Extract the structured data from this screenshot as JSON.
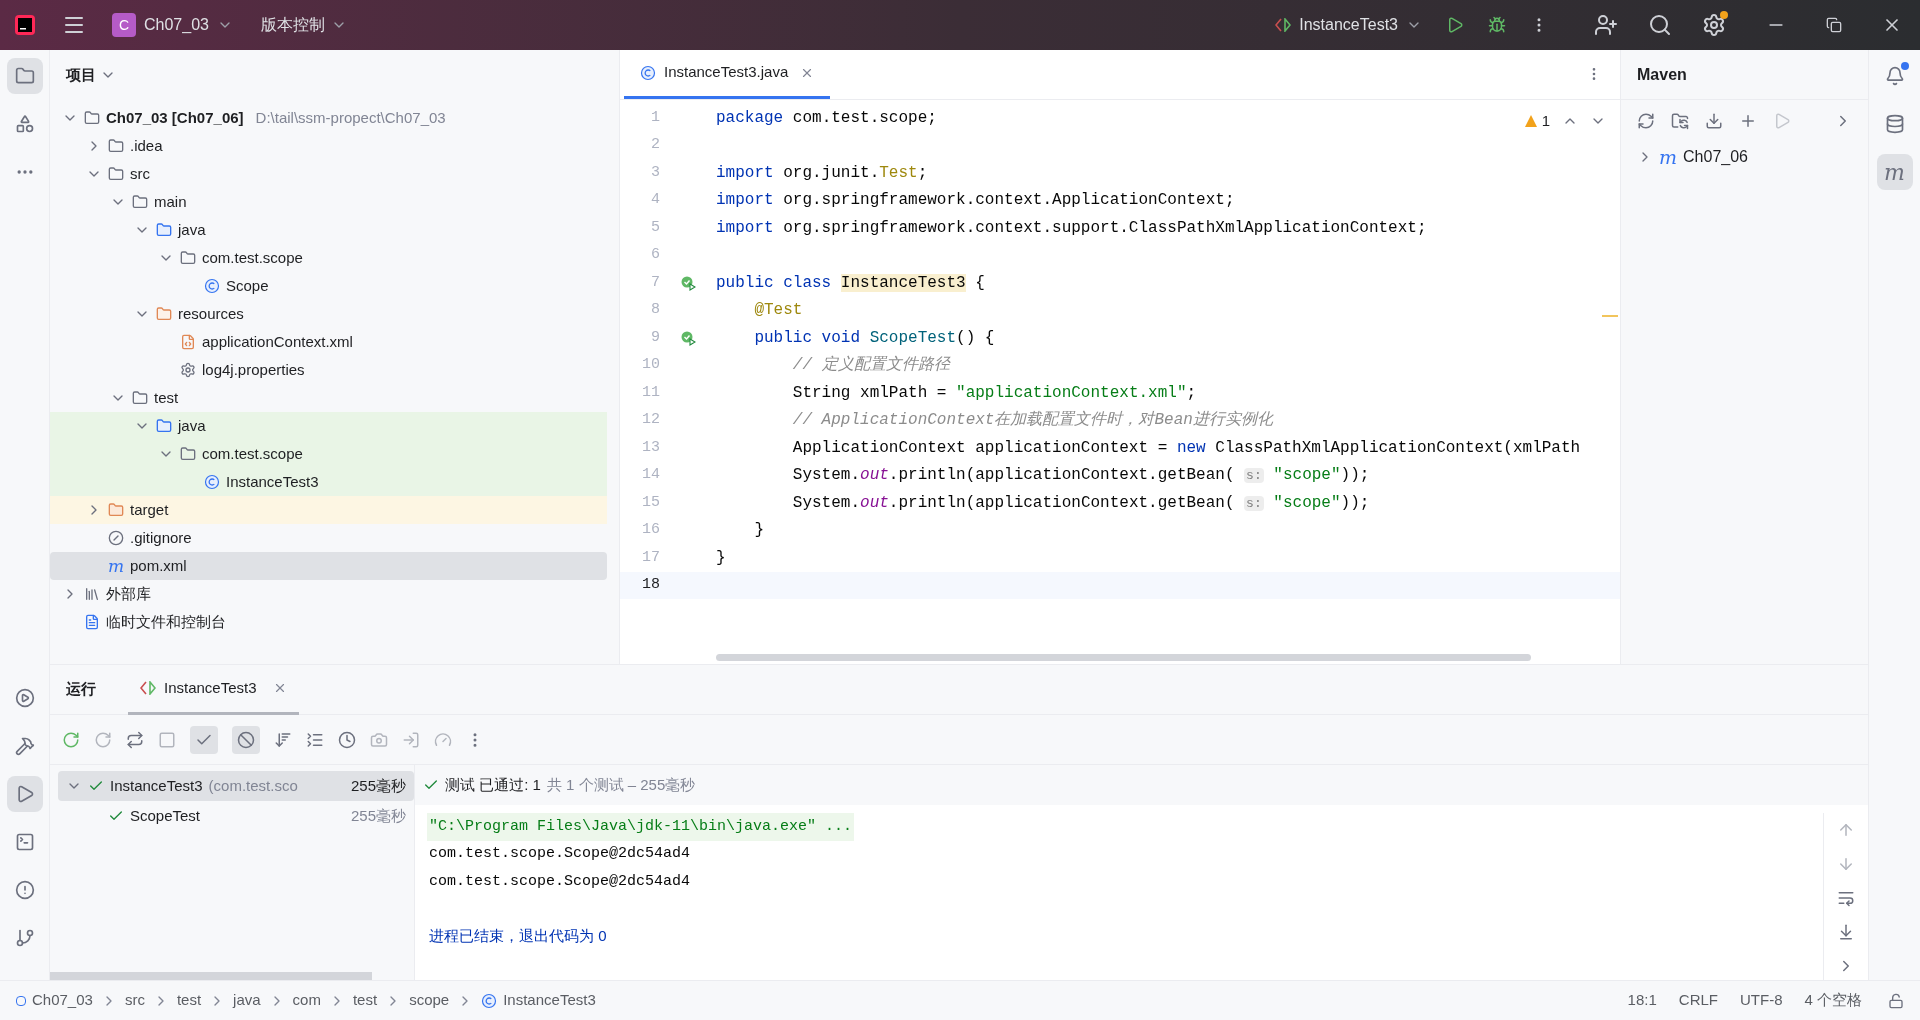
{
  "title_bar": {
    "project_badge": "C",
    "project": "Ch07_03",
    "vcs": "版本控制",
    "run_config": "InstanceTest3"
  },
  "project_panel": {
    "title": "项目",
    "tree": [
      {
        "kind": "module",
        "label": "Ch07_03 [Ch07_06]",
        "path": "D:\\tail\\ssm-propect\\Ch07_03",
        "expanded": true,
        "selected": false,
        "children": [
          {
            "kind": "folder",
            "label": ".idea",
            "expanded": false,
            "selected": false
          },
          {
            "kind": "folder",
            "label": "src",
            "expanded": true,
            "selected": false,
            "children": [
              {
                "kind": "folder",
                "label": "main",
                "expanded": true,
                "selected": false,
                "children": [
                  {
                    "kind": "source-root",
                    "label": "java",
                    "expanded": true,
                    "selected": false,
                    "children": [
                      {
                        "kind": "package",
                        "label": "com.test.scope",
                        "expanded": true,
                        "selected": false,
                        "children": [
                          {
                            "kind": "class",
                            "label": "Scope",
                            "selected": false
                          }
                        ]
                      }
                    ]
                  },
                  {
                    "kind": "resources-root",
                    "label": "resources",
                    "expanded": true,
                    "selected": false,
                    "children": [
                      {
                        "kind": "xml",
                        "label": "applicationContext.xml",
                        "selected": false
                      },
                      {
                        "kind": "properties",
                        "label": "log4j.properties",
                        "selected": false
                      }
                    ]
                  }
                ]
              },
              {
                "kind": "folder",
                "label": "test",
                "expanded": true,
                "selected": false,
                "children": [
                  {
                    "kind": "test-root",
                    "label": "java",
                    "expanded": true,
                    "selected": false,
                    "children": [
                      {
                        "kind": "package",
                        "label": "com.test.scope",
                        "expanded": true,
                        "selected": false,
                        "children": [
                          {
                            "kind": "class",
                            "label": "InstanceTest3",
                            "selected": false
                          }
                        ]
                      }
                    ]
                  }
                ]
              }
            ]
          },
          {
            "kind": "excluded",
            "label": "target",
            "expanded": false,
            "selected": false
          },
          {
            "kind": "ignore",
            "label": ".gitignore",
            "selected": false
          },
          {
            "kind": "pom",
            "label": "pom.xml",
            "icon_text": "m",
            "selected": true
          }
        ]
      },
      {
        "kind": "library",
        "label": "外部库",
        "expanded": false,
        "selected": false
      },
      {
        "kind": "scratch",
        "label": "临时文件和控制台",
        "selected": false
      }
    ]
  },
  "editor": {
    "tab": {
      "label": "InstanceTest3.java",
      "selected": true
    },
    "warnings": "1",
    "lines": [
      {
        "n": "1",
        "tokens": [
          {
            "kind": "keyword",
            "text": "package"
          },
          {
            "kind": "plain",
            "text": " com.test.scope;"
          }
        ]
      },
      {
        "n": "2"
      },
      {
        "n": "3",
        "tokens": [
          {
            "kind": "keyword",
            "text": "import"
          },
          {
            "kind": "plain",
            "text": " org.junit."
          },
          {
            "kind": "annotation",
            "text": "Test"
          },
          {
            "kind": "plain",
            "text": ";"
          }
        ]
      },
      {
        "n": "4",
        "tokens": [
          {
            "kind": "keyword",
            "text": "import"
          },
          {
            "kind": "plain",
            "text": " org.springframework.context.ApplicationContext;"
          }
        ]
      },
      {
        "n": "5",
        "tokens": [
          {
            "kind": "keyword",
            "text": "import"
          },
          {
            "kind": "plain",
            "text": " org.springframework.context.support.ClassPathXmlApplicationContext;"
          }
        ]
      },
      {
        "n": "6"
      },
      {
        "n": "7",
        "run_marker": true,
        "tokens": [
          {
            "kind": "keyword",
            "text": "public class "
          },
          {
            "kind": "class-decl",
            "text": "InstanceTest3"
          },
          {
            "kind": "plain",
            "text": " {"
          }
        ]
      },
      {
        "n": "8",
        "tokens": [
          {
            "kind": "annotation",
            "text": "    @Test"
          }
        ]
      },
      {
        "n": "9",
        "run_marker": true,
        "tokens": [
          {
            "kind": "keyword",
            "text": "    public void "
          },
          {
            "kind": "method-decl",
            "text": "ScopeTest"
          },
          {
            "kind": "plain",
            "text": "() {"
          }
        ]
      },
      {
        "n": "10",
        "tokens": [
          {
            "kind": "comment",
            "text": "        // 定义配置文件路径"
          }
        ]
      },
      {
        "n": "11",
        "tokens": [
          {
            "kind": "plain",
            "text": "        String xmlPath = "
          },
          {
            "kind": "string",
            "text": "\"applicationContext.xml\""
          },
          {
            "kind": "plain",
            "text": ";"
          }
        ]
      },
      {
        "n": "12",
        "tokens": [
          {
            "kind": "comment",
            "text": "        // ApplicationContext在加载配置文件时，对Bean进行实例化"
          }
        ]
      },
      {
        "n": "13",
        "tokens": [
          {
            "kind": "plain",
            "text": "        ApplicationContext applicationContext = "
          },
          {
            "kind": "keyword",
            "text": "new"
          },
          {
            "kind": "plain",
            "text": " ClassPathXmlApplicationContext(xmlPath"
          }
        ]
      },
      {
        "n": "14",
        "tokens": [
          {
            "kind": "plain",
            "text": "        System."
          },
          {
            "kind": "static-field",
            "text": "out"
          },
          {
            "kind": "plain",
            "text": ".println(applicationContext.getBean( "
          },
          {
            "kind": "hint",
            "text": "s:"
          },
          {
            "kind": "string",
            "text": " \"scope\""
          },
          {
            "kind": "plain",
            "text": "));"
          }
        ]
      },
      {
        "n": "15",
        "tokens": [
          {
            "kind": "plain",
            "text": "        System."
          },
          {
            "kind": "static-field",
            "text": "out"
          },
          {
            "kind": "plain",
            "text": ".println(applicationContext.getBean( "
          },
          {
            "kind": "hint",
            "text": "s:"
          },
          {
            "kind": "string",
            "text": " \"scope\""
          },
          {
            "kind": "plain",
            "text": "));"
          }
        ]
      },
      {
        "n": "16",
        "tokens": [
          {
            "kind": "plain",
            "text": "    }"
          }
        ]
      },
      {
        "n": "17",
        "tokens": [
          {
            "kind": "plain",
            "text": "}"
          }
        ]
      },
      {
        "n": "18",
        "current": true
      }
    ]
  },
  "maven": {
    "title": "Maven",
    "tree": [
      {
        "label": "Ch07_06",
        "icon_text": "m",
        "expanded": false
      }
    ]
  },
  "right_strip": {
    "maven_button": {
      "icon_text": "m",
      "selected": true
    }
  },
  "run_panel": {
    "title": "运行",
    "tab": {
      "label": "InstanceTest3",
      "selected": true
    },
    "toggles": [
      {
        "on": true
      },
      {
        "on": true
      }
    ],
    "tests": [
      {
        "name": "InstanceTest3",
        "detail": "(com.test.sco",
        "time": "255毫秒",
        "passed": true,
        "expanded": true,
        "selected": true,
        "children": [
          {
            "name": "ScopeTest",
            "time": "255毫秒",
            "passed": true,
            "selected": false
          }
        ]
      }
    ],
    "status": {
      "passed_label": "测试 已通过: 1",
      "summary": "共 1 个测试 – 255毫秒"
    },
    "console": [
      {
        "kind": "command",
        "text": "\"C:\\Program Files\\Java\\jdk-11\\bin\\java.exe\" ..."
      },
      {
        "kind": "output",
        "text": "com.test.scope.Scope@2dc54ad4"
      },
      {
        "kind": "output",
        "text": "com.test.scope.Scope@2dc54ad4"
      },
      {
        "kind": "exit",
        "text": "进程已结束，退出代码为 0"
      }
    ]
  },
  "status_bar": {
    "breadcrumbs": [
      {
        "kind": "module",
        "label": "Ch07_03"
      },
      {
        "kind": "folder",
        "label": "src"
      },
      {
        "kind": "folder",
        "label": "test"
      },
      {
        "kind": "folder",
        "label": "java"
      },
      {
        "kind": "folder",
        "label": "com"
      },
      {
        "kind": "folder",
        "label": "test"
      },
      {
        "kind": "folder",
        "label": "scope"
      },
      {
        "kind": "class",
        "label": "InstanceTest3"
      }
    ],
    "items": [
      "18:1",
      "CRLF",
      "UTF-8",
      "4 个空格"
    ]
  }
}
